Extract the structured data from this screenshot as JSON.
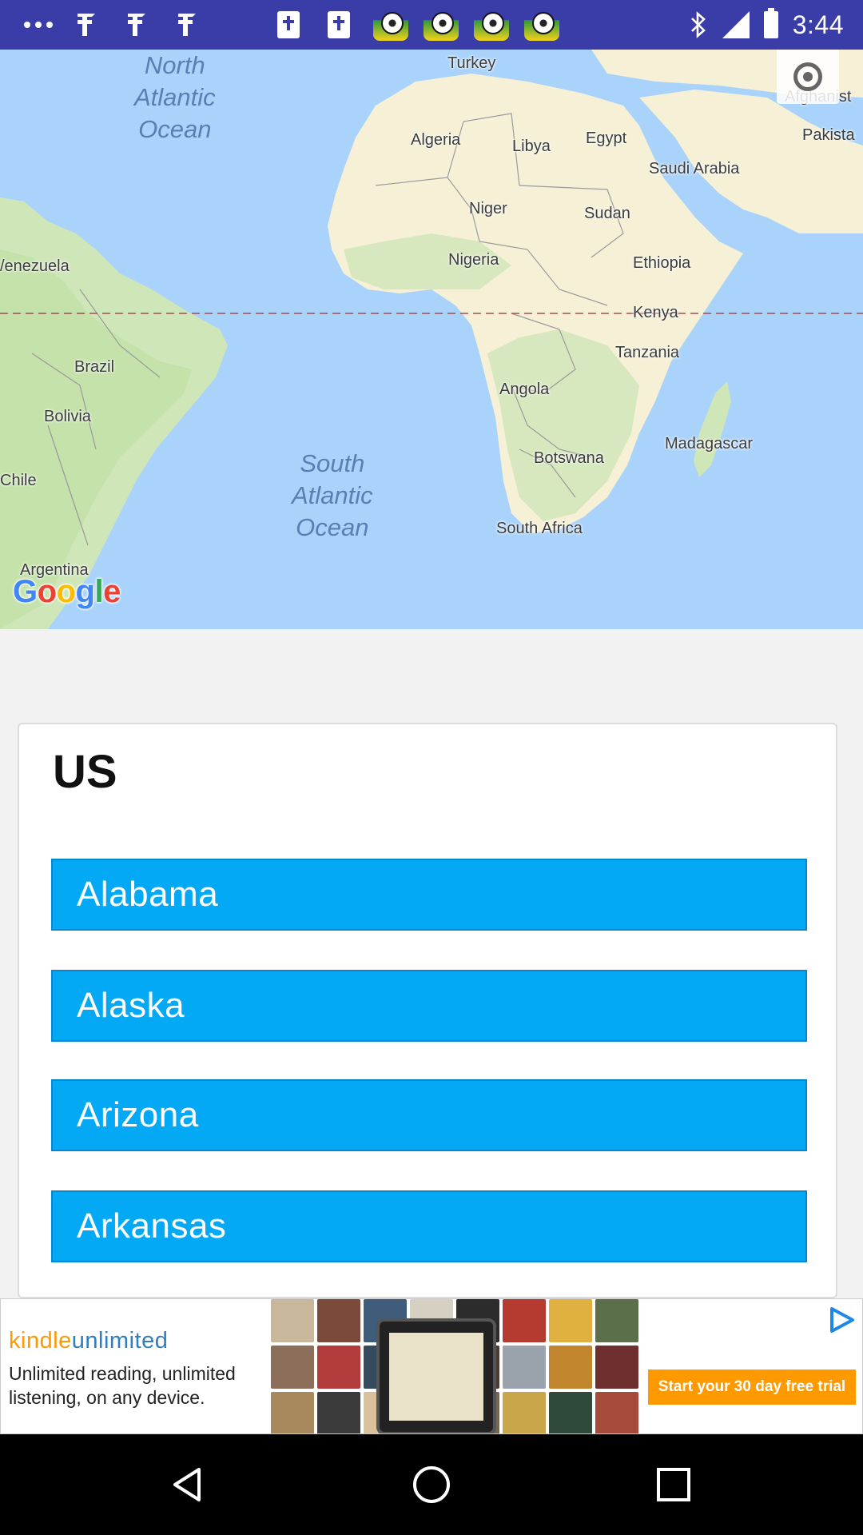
{
  "status_bar": {
    "time": "3:44",
    "left_icons": [
      "more-dots-icon",
      "cross-icon",
      "cross-icon",
      "cross-icon",
      "bible-icon",
      "bible-icon",
      "soccer-ball-icon",
      "soccer-ball-icon",
      "soccer-ball-icon",
      "soccer-ball-icon"
    ],
    "right_icons": [
      "bluetooth-icon",
      "signal-icon",
      "battery-icon"
    ],
    "background": "#3a3ca8"
  },
  "map": {
    "attribution": "Google",
    "labels": {
      "north_atlantic": "North\nAtlantic\nOcean",
      "south_atlantic": "South\nAtlantic\nOcean",
      "turkey": "Turkey",
      "afghanistan": "Afghanist",
      "pakistan": "Pakista",
      "algeria": "Algeria",
      "libya": "Libya",
      "egypt": "Egypt",
      "saudi_arabia": "Saudi Arabia",
      "niger": "Niger",
      "sudan": "Sudan",
      "venezuela": "/enezuela",
      "nigeria": "Nigeria",
      "ethiopia": "Ethiopia",
      "kenya": "Kenya",
      "brazil": "Brazil",
      "tanzania": "Tanzania",
      "bolivia": "Bolivia",
      "angola": "Angola",
      "madagascar": "Madagascar",
      "botswana": "Botswana",
      "chile": "Chile",
      "south_africa": "South Africa",
      "argentina": "Argentina"
    },
    "colors": {
      "water": "#aad3fb",
      "land": "#f5f0d6",
      "green": "#cfe6b8",
      "equator": "#a05050"
    }
  },
  "card": {
    "title": "US",
    "states": [
      "Alabama",
      "Alaska",
      "Arizona",
      "Arkansas"
    ],
    "button_color": "#03a9f4"
  },
  "ad": {
    "logo_kindle": "kindle",
    "logo_unlimited": "unlimited",
    "text": "Unlimited reading, unlimited listening, on any device.",
    "cta": "Start your 30 day free trial"
  },
  "nav_bar": {
    "buttons": [
      "back-icon",
      "home-icon",
      "recents-icon"
    ]
  }
}
